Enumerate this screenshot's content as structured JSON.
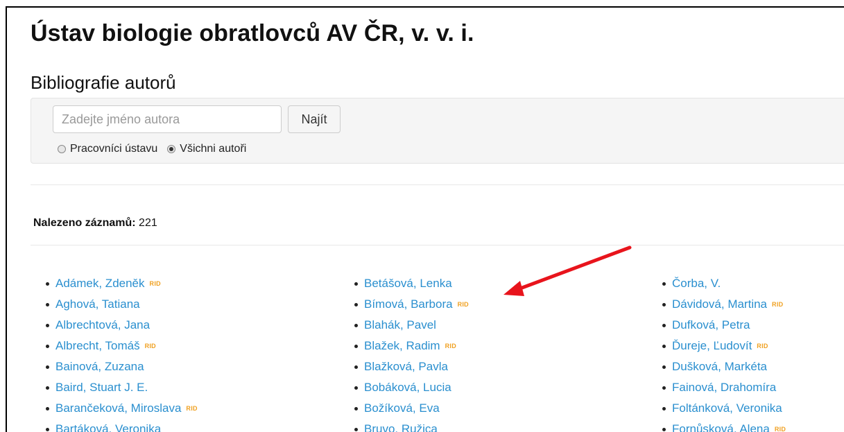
{
  "header": {
    "institute_title": "Ústav biologie obratlovců AV ČR, v. v. i.",
    "section_title": "Bibliografie autorů"
  },
  "search": {
    "placeholder": "Zadejte jméno autora",
    "value": "",
    "button_label": "Najít",
    "options": [
      {
        "label": "Pracovníci ústavu",
        "checked": false
      },
      {
        "label": "Všichni autoři",
        "checked": true
      }
    ]
  },
  "results": {
    "count_label": "Nalezeno záznamů:",
    "count_value": "221"
  },
  "rid_badge": "RID",
  "authors": {
    "col1": [
      {
        "name": "Adámek, Zdeněk",
        "rid": true
      },
      {
        "name": "Aghová, Tatiana",
        "rid": false
      },
      {
        "name": "Albrechtová, Jana",
        "rid": false
      },
      {
        "name": "Albrecht, Tomáš",
        "rid": true
      },
      {
        "name": "Bainová, Zuzana",
        "rid": false
      },
      {
        "name": "Baird, Stuart J. E.",
        "rid": false
      },
      {
        "name": "Barančeková, Miroslava",
        "rid": true
      },
      {
        "name": "Bartáková, Veronika",
        "rid": false
      }
    ],
    "col2": [
      {
        "name": "Betášová, Lenka",
        "rid": false
      },
      {
        "name": "Bímová, Barbora",
        "rid": true
      },
      {
        "name": "Blahák, Pavel",
        "rid": false
      },
      {
        "name": "Blažek, Radim",
        "rid": true
      },
      {
        "name": "Blažková, Pavla",
        "rid": false
      },
      {
        "name": "Bobáková, Lucia",
        "rid": false
      },
      {
        "name": "Božíková, Eva",
        "rid": false
      },
      {
        "name": "Bruvo, Ružica",
        "rid": false
      }
    ],
    "col3": [
      {
        "name": "Čorba, V.",
        "rid": false
      },
      {
        "name": "Dávidová, Martina",
        "rid": true
      },
      {
        "name": "Dufková, Petra",
        "rid": false
      },
      {
        "name": "Ďureje, Ľudovít",
        "rid": true
      },
      {
        "name": "Dušková, Markéta",
        "rid": false
      },
      {
        "name": "Fainová, Drahomíra",
        "rid": false
      },
      {
        "name": "Foltánková, Veronika",
        "rid": false
      },
      {
        "name": "Fornůsková, Alena",
        "rid": true
      }
    ]
  },
  "colors": {
    "link": "#2a8fcf",
    "rid_badge": "#f0a020",
    "annotation_arrow": "#e8141c"
  }
}
